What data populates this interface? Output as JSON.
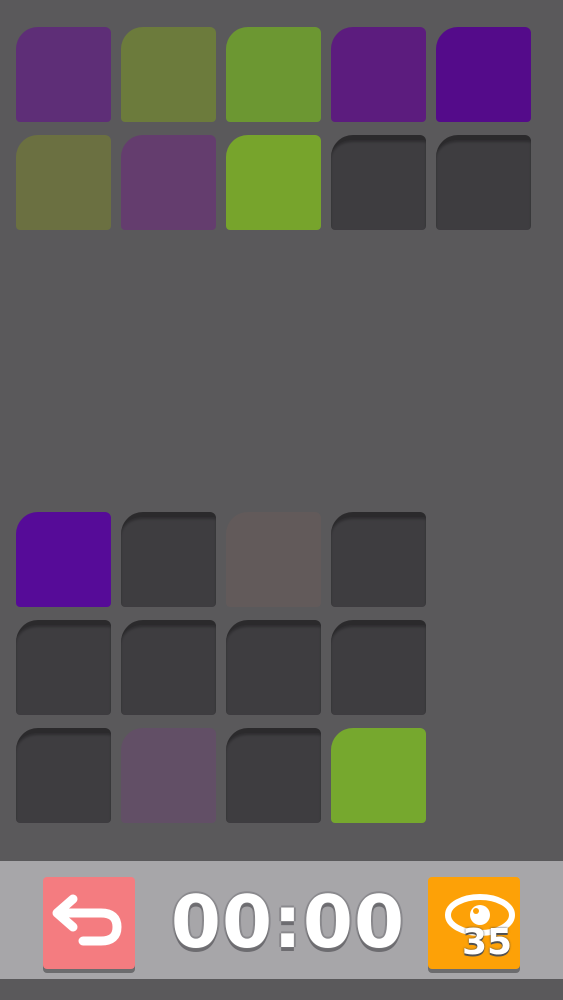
{
  "colors": {
    "background": "#5a595b",
    "bar": "#a7a6a9",
    "empty_tile": "#3e3d40",
    "undo_button": "#f47c80",
    "hint_button": "#fda107"
  },
  "top_grid": {
    "tiles": [
      {
        "state": "filled",
        "color": "#5e2e77"
      },
      {
        "state": "filled",
        "color": "#6c7b3c"
      },
      {
        "state": "filled",
        "color": "#6c9732"
      },
      {
        "state": "filled",
        "color": "#5c1c7e"
      },
      {
        "state": "filled",
        "color": "#540b8a"
      },
      {
        "state": "filled",
        "color": "#6b7041"
      },
      {
        "state": "filled",
        "color": "#643d6e"
      },
      {
        "state": "filled",
        "color": "#77a42c"
      },
      {
        "state": "empty"
      },
      {
        "state": "empty"
      }
    ]
  },
  "bottom_grid": {
    "tiles": [
      {
        "state": "filled",
        "color": "#560b98"
      },
      {
        "state": "empty"
      },
      {
        "state": "filled",
        "color": "#625a5a"
      },
      {
        "state": "empty"
      },
      {
        "state": "empty"
      },
      {
        "state": "empty"
      },
      {
        "state": "empty"
      },
      {
        "state": "empty"
      },
      {
        "state": "empty"
      },
      {
        "state": "filled",
        "color": "#624f66"
      },
      {
        "state": "empty"
      },
      {
        "state": "filled",
        "color": "#76a82e"
      }
    ]
  },
  "toolbar": {
    "undo_icon": "undo-arrow-icon",
    "timer": "00:00",
    "hint_icon": "hint-eye-icon",
    "hint_count": "35"
  }
}
